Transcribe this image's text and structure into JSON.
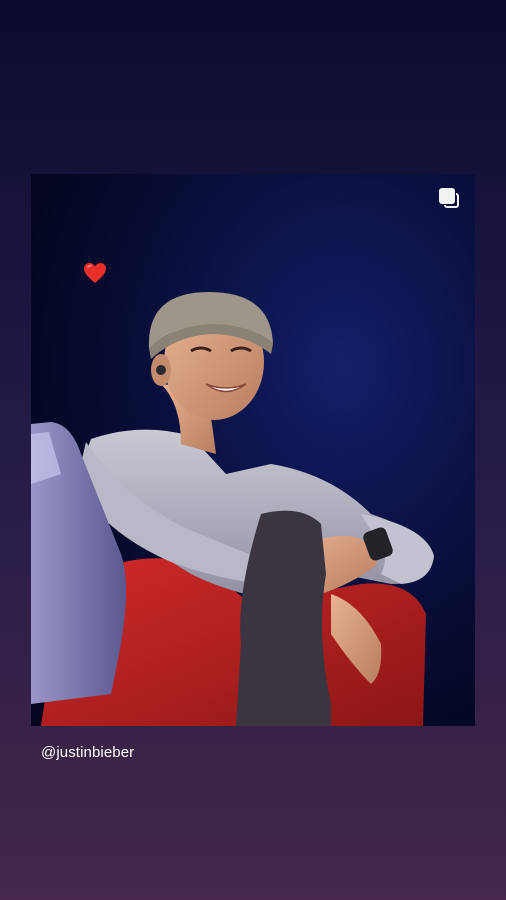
{
  "story": {
    "mention": "@justinbieber",
    "multi_post_icon": "multiple-posts-icon",
    "sticker": "red-heart-emoji"
  },
  "colors": {
    "background_top": "#0b0b2e",
    "background_bottom": "#45284a",
    "heart": "#e8302a",
    "mention_text": "#ffffff"
  }
}
